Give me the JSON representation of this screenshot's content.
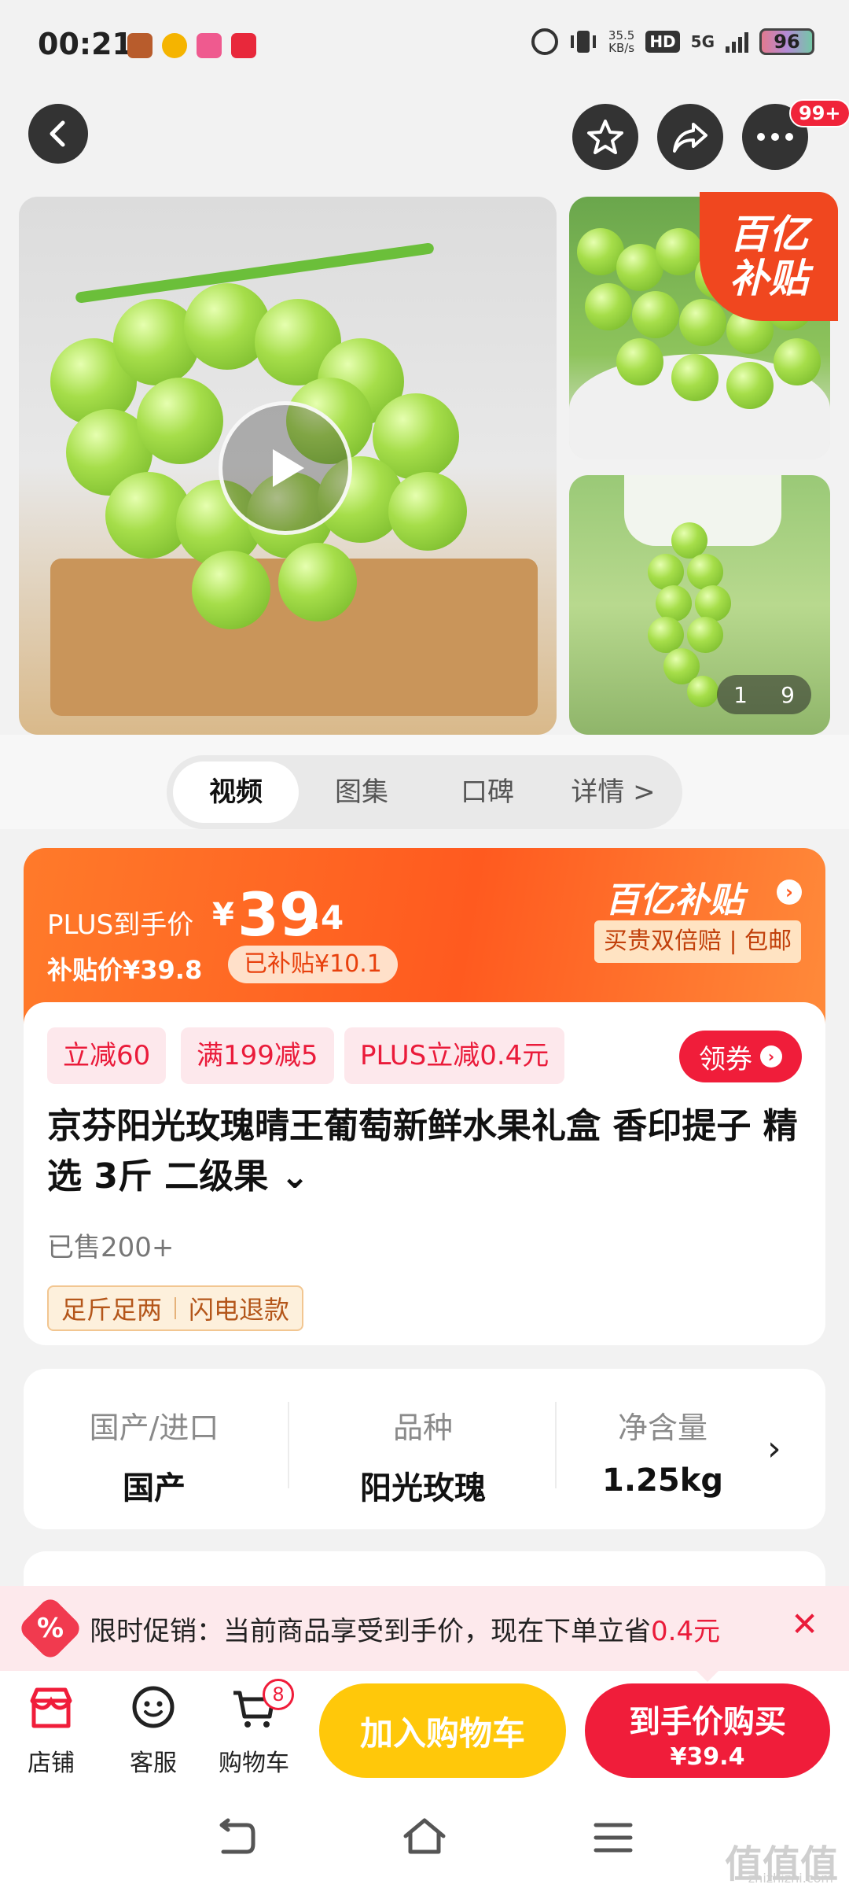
{
  "status_bar": {
    "time": "00:21",
    "net_speed_value": "35.5",
    "net_speed_unit": "KB/s",
    "hd": "HD",
    "network": "5G",
    "battery": "96"
  },
  "top_nav": {
    "message_badge": "99+"
  },
  "gallery": {
    "subsidy_badge_line1": "百亿",
    "subsidy_badge_line2": "补贴",
    "counter_current": "1",
    "counter_total": "9"
  },
  "media_tabs": [
    {
      "label": "视频",
      "active": true
    },
    {
      "label": "图集",
      "active": false
    },
    {
      "label": "口碑",
      "active": false
    },
    {
      "label": "详情 >",
      "active": false
    }
  ],
  "price_banner": {
    "plus_label": "PLUS到手价",
    "currency": "¥",
    "price_int": "39",
    "price_dec": ".4",
    "subsidy_price": "补贴价¥39.8",
    "subsidized_tag": "已补贴¥10.1",
    "program_name": "百亿补贴",
    "guarantee": "买贵双倍赔 | 包邮",
    "accent_color": "#ff5a1f"
  },
  "product": {
    "promo_tags": [
      "立减60",
      "满199减5",
      "PLUS立减0.4元"
    ],
    "coupon_label": "领券",
    "title": "京芬阳光玫瑰晴王葡萄新鲜水果礼盒 香印提子 精选 3斤 二级果 ⌄",
    "sold": "已售200+",
    "service_tags": [
      "足斤足两",
      "闪电退款"
    ]
  },
  "specs": [
    {
      "label": "国产/进口",
      "value": "国产"
    },
    {
      "label": "品种",
      "value": "阳光玫瑰"
    },
    {
      "label": "净含量",
      "value": "1.25kg"
    }
  ],
  "promo_strip": {
    "text": "限时促销：当前商品享受到手价，现在下单立省",
    "amount": "0.4元"
  },
  "bottom_bar": {
    "store_label": "店铺",
    "service_label": "客服",
    "cart_label": "购物车",
    "cart_count": "8",
    "add_cart_label": "加入购物车",
    "buy_label": "到手价购买",
    "buy_price": "¥39.4",
    "brand_red": "#f01d3a",
    "brand_yellow": "#ffc80a"
  },
  "watermark": {
    "text": "值值值",
    "sub": "zhizhizhi.com"
  }
}
